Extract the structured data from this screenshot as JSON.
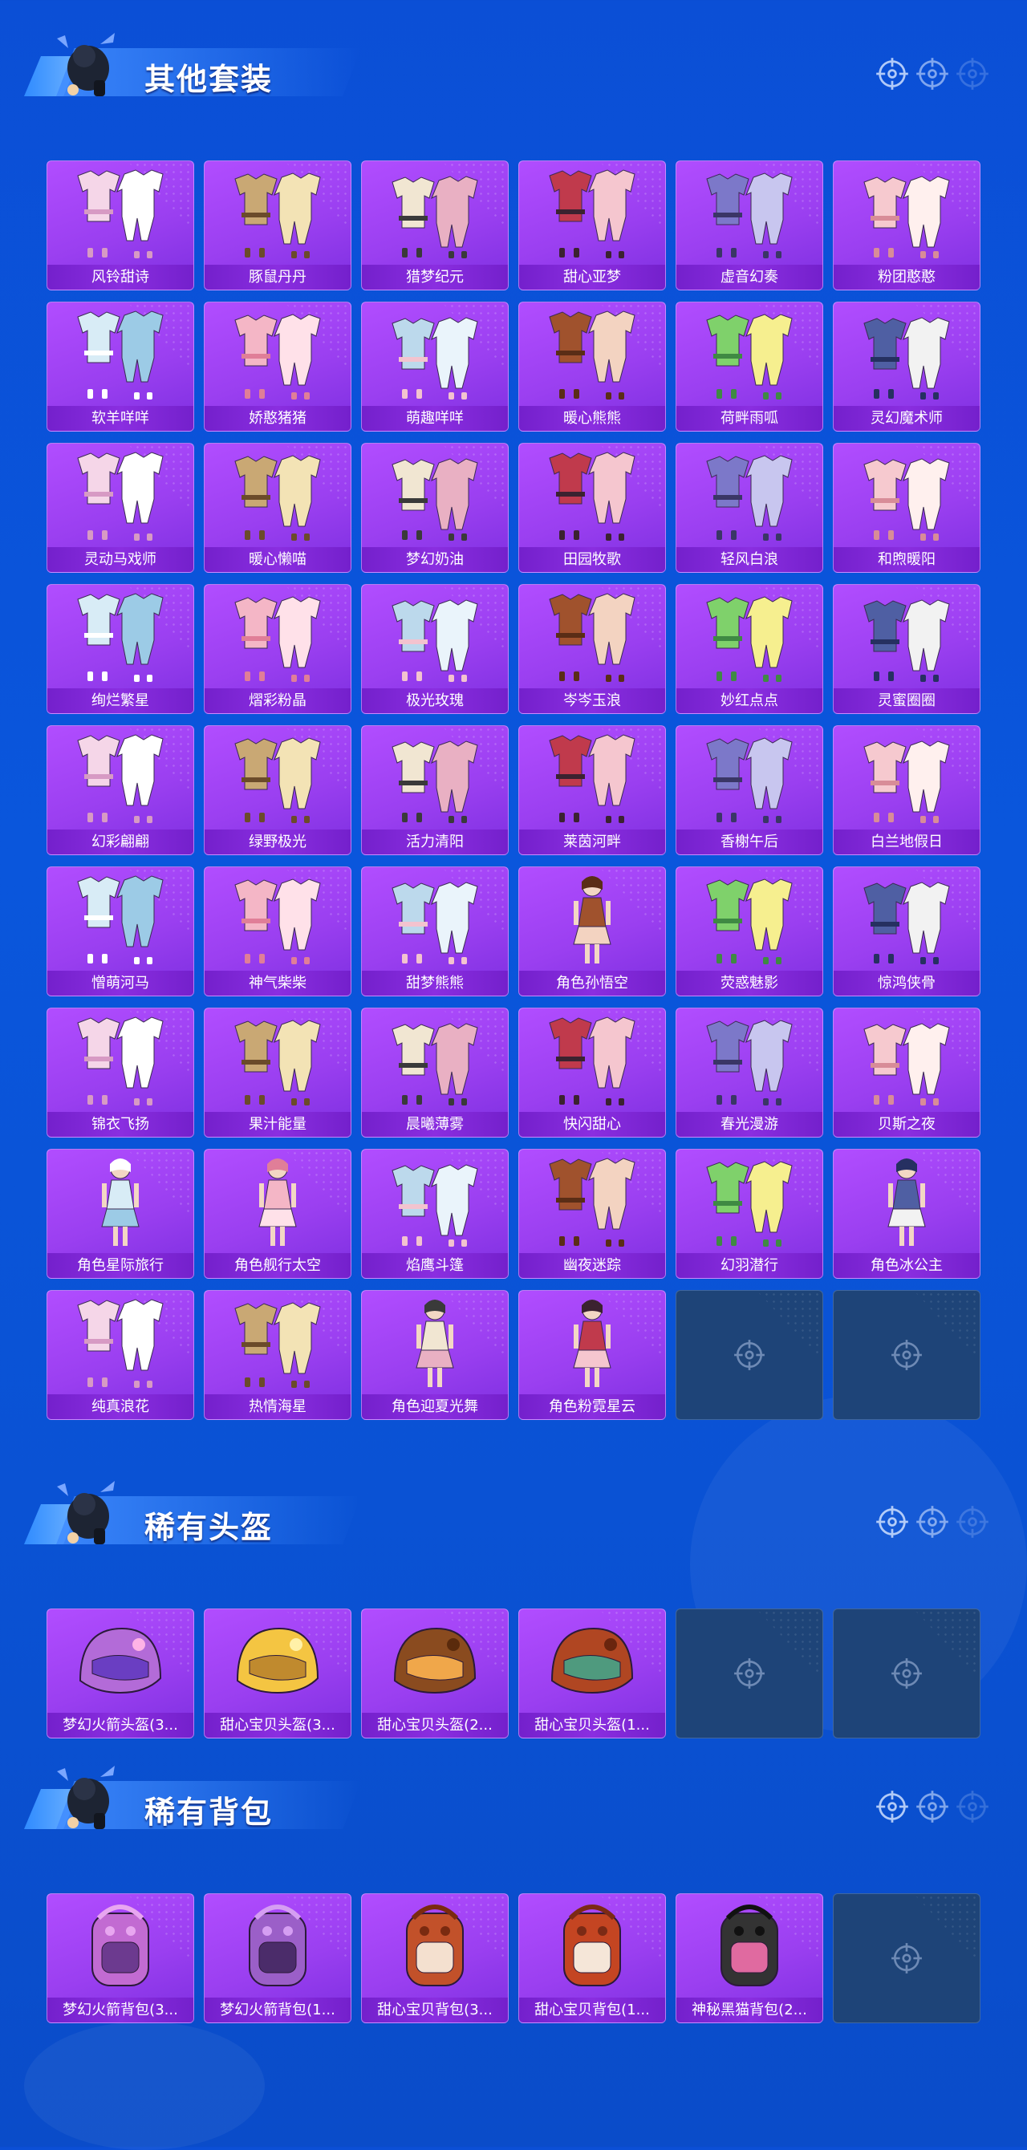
{
  "sections": [
    {
      "title": "其他套装",
      "items": [
        "风铃甜诗",
        "豚鼠丹丹",
        "猎梦纪元",
        "甜心亚梦",
        "虚音幻奏",
        "粉团憨憨",
        "软羊咩咩",
        "娇憨猪猪",
        "萌趣咩咩",
        "暖心熊熊",
        "荷畔雨呱",
        "灵幻魔术师",
        "灵动马戏师",
        "暖心懒喵",
        "梦幻奶油",
        "田园牧歌",
        "轻风白浪",
        "和煦暖阳",
        "绚烂繁星",
        "熠彩粉晶",
        "极光玫瑰",
        "岑岑玉浪",
        "妙红点点",
        "灵蜜圈圈",
        "幻彩翩翩",
        "绿野极光",
        "活力清阳",
        "莱茵河畔",
        "香榭午后",
        "白兰地假日",
        "憎萌河马",
        "神气柴柴",
        "甜梦熊熊",
        "角色孙悟空",
        "荧惑魅影",
        "惊鸿侠骨",
        "锦衣飞扬",
        "果汁能量",
        "晨曦薄雾",
        "快闪甜心",
        "春光漫游",
        "贝斯之夜",
        "角色星际旅行",
        "角色舰行太空",
        "焰鹰斗篷",
        "幽夜迷踪",
        "幻羽潜行",
        "角色冰公主",
        "纯真浪花",
        "热情海星",
        "角色迎夏光舞",
        "角色粉霓星云"
      ],
      "empty_slots": 2
    },
    {
      "title": "稀有头盔",
      "items": [
        "梦幻火箭头盔(3...",
        "甜心宝贝头盔(3...",
        "甜心宝贝头盔(2...",
        "甜心宝贝头盔(1..."
      ],
      "empty_slots": 2
    },
    {
      "title": "稀有背包",
      "items": [
        "梦幻火箭背包(3...",
        "梦幻火箭背包(1...",
        "甜心宝贝背包(3...",
        "甜心宝贝背包(1...",
        "神秘黑猫背包(2..."
      ],
      "empty_slots": 1
    }
  ],
  "icons": {
    "reticle": "crosshair-icon",
    "empty_slot": "empty-slot-crosshair-icon",
    "mascot": "mascot-icon"
  },
  "colors": {
    "background": "#0b4fd6",
    "card_purple": "#a445f5",
    "label_purple": "#7b26d4",
    "empty_slot": "#1e4478"
  }
}
